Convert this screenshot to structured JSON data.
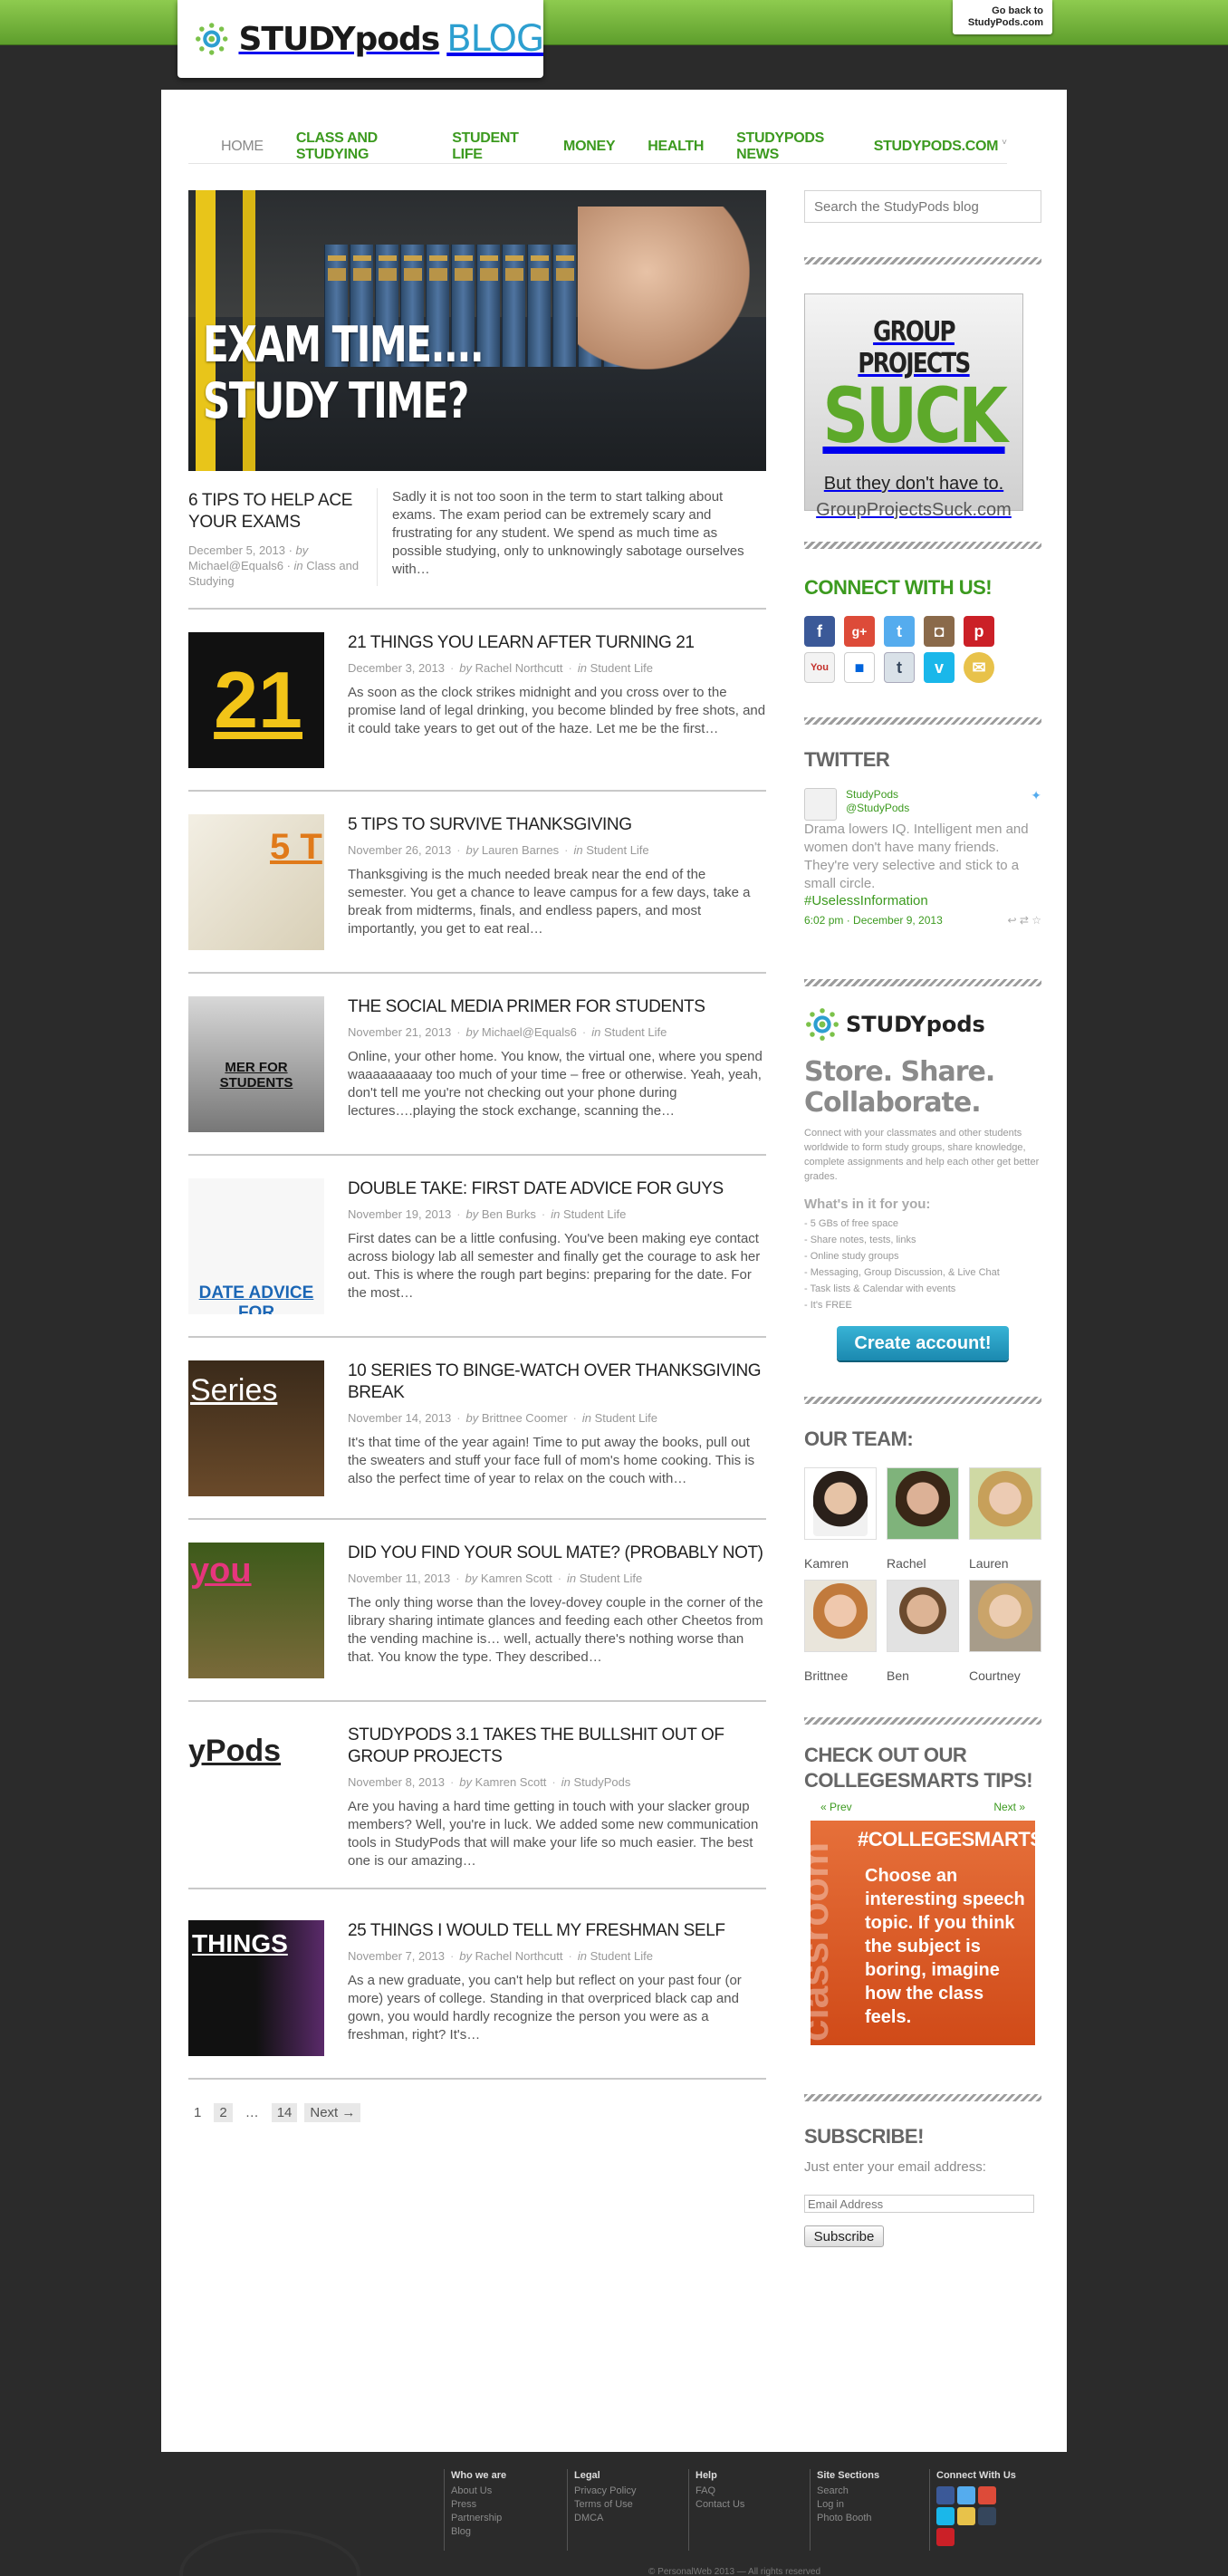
{
  "header": {
    "logo_text": "STUDYpods",
    "logo_blog": "BLOG",
    "back_link": "Go back to StudyPods.com"
  },
  "nav": {
    "items": [
      "HOME",
      "CLASS AND STUDYING",
      "STUDENT LIFE",
      "MONEY",
      "HEALTH",
      "STUDYPODS NEWS",
      "STUDYPODS.COM"
    ]
  },
  "featured": {
    "image_text_line1": "EXAM TIME....",
    "image_text_line2": "STUDY TIME?",
    "title": "6 TIPS TO HELP ACE YOUR EXAMS",
    "date": "December 5, 2013",
    "by": "by",
    "author": "Michael@Equals6",
    "in": "in",
    "category": "Class and Studying",
    "excerpt": "Sadly it is not too soon in the term to start talking about exams.  The exam period can be extremely scary and frustrating for any student. We spend as much time as possible studying, only to unknowingly sabotage ourselves with…"
  },
  "posts": [
    {
      "title": "21 THINGS YOU LEARN AFTER TURNING 21",
      "date": "December 3, 2013",
      "author": "Rachel Northcutt",
      "category": "Student Life",
      "excerpt": "As soon as the clock strikes midnight and you cross over to the promise land of legal drinking, you become blinded by free shots, and it could take years to get out of the haze. Let me be the first…",
      "thumb_text": "21"
    },
    {
      "title": "5 TIPS TO SURVIVE THANKSGIVING",
      "date": "November 26, 2013",
      "author": "Lauren Barnes",
      "category": "Student Life",
      "excerpt": "Thanksgiving is the much needed break near the end of the semester. You get a chance to leave campus for a few days, take a break from midterms, finals, and endless papers, and most importantly, you get to eat real…",
      "thumb_text": "5 T"
    },
    {
      "title": "THE SOCIAL MEDIA PRIMER FOR STUDENTS",
      "date": "November 21, 2013",
      "author": "Michael@Equals6",
      "category": "Student Life",
      "excerpt": "Online, your other home.  You know, the virtual one, where you spend waaaaaaaaay too much of your time – free or otherwise.  Yeah, yeah, don't tell me you're not checking out your phone during lectures….playing the stock exchange, scanning the…",
      "thumb_text": "MER FOR STUDENTS"
    },
    {
      "title": "DOUBLE TAKE: FIRST DATE ADVICE FOR GUYS",
      "date": "November 19, 2013",
      "author": "Ben Burks",
      "category": "Student Life",
      "excerpt": "First dates can be a little confusing. You've been making eye contact across biology lab all semester and finally get the courage to ask her out. This is where the rough part begins: preparing for the date. For the most…",
      "thumb_text": "DATE ADVICE FOR"
    },
    {
      "title": "10 SERIES TO BINGE-WATCH OVER THANKSGIVING BREAK",
      "date": "November 14, 2013",
      "author": "Brittnee Coomer",
      "category": "Student Life",
      "excerpt": "It's that time of the year again! Time to put away the books, pull out the sweaters and stuff your face full of mom's home cooking. This is also the perfect time of year to relax on the couch with…",
      "thumb_text": "Series"
    },
    {
      "title": "DID YOU FIND YOUR SOUL MATE? (PROBABLY NOT)",
      "date": "November 11, 2013",
      "author": "Kamren Scott",
      "category": "Student Life",
      "excerpt": "The only thing worse than the lovey-dovey couple in the corner of the library sharing intimate glances and feeding each other Cheetos from the vending machine is… well, actually there's nothing worse than that. You know the type. They described…",
      "thumb_text": "you"
    },
    {
      "title": "STUDYPODS 3.1 TAKES THE BULLSHIT OUT OF GROUP PROJECTS",
      "date": "November 8, 2013",
      "author": "Kamren Scott",
      "category": "StudyPods",
      "excerpt": "Are you having a hard time getting in touch with your slacker group members? Well, you're in luck. We added some new communication tools in StudyPods that will make your life so much easier. The best one is our amazing…",
      "thumb_text": "yPods"
    },
    {
      "title": "25 THINGS I WOULD TELL MY FRESHMAN SELF",
      "date": "November 7, 2013",
      "author": "Rachel Northcutt",
      "category": "Student Life",
      "excerpt": "As a new graduate, you can't help but reflect on your past four (or more) years of college.  Standing in that overpriced black cap and gown, you would hardly recognize the person you were as a freshman, right?   It's…",
      "thumb_text": "THINGS"
    }
  ],
  "meta_words": {
    "by": "by",
    "in": "in"
  },
  "pagination": {
    "p1": "1",
    "p2": "2",
    "dots": "…",
    "last": "14",
    "next": "Next →"
  },
  "sidebar": {
    "search_placeholder": "Search the StudyPods blog",
    "ad": {
      "l1": "GROUP PROJECTS",
      "l2": "SUCK",
      "l3": "But they don't have to.",
      "l4": "GroupProjectsSuck.com"
    },
    "connect_title": "CONNECT WITH US!",
    "twitter": {
      "title": "TWITTER",
      "name": "StudyPods",
      "handle": "@StudyPods",
      "text": "Drama lowers IQ. Intelligent men and women don't have many friends. They're very selective and stick to a small circle.",
      "tag": "#UselessInformation",
      "time": "6:02 pm · December 9, 2013"
    },
    "studypods": {
      "logo": "STUDYpods",
      "title": "Store. Share. Collaborate.",
      "sub": "Connect with your classmates and other students worldwide to form study groups, share knowledge, complete assignments and help each other get better grades.",
      "h": "What's in it for you:",
      "list": [
        "- 5 GBs of free space",
        "- Share notes, tests, links",
        "- Online study groups",
        "- Messaging, Group Discussion, & Live Chat",
        "- Task lists & Calendar with events",
        "- It's FREE"
      ],
      "button": "Create account!"
    },
    "team_title": "OUR TEAM:",
    "team": [
      "Kamren",
      "Rachel",
      "Lauren",
      "Brittnee",
      "Ben",
      "Courtney"
    ],
    "cs_title": "CHECK OUT OUR COLLEGESMARTS TIPS!",
    "cs_prev": "« Prev",
    "cs_next": "Next »",
    "cs_hash": "#COLLEGESMARTS",
    "cs_vert": "classroom",
    "cs_msg": "Choose an interesting speech topic.  If you think the subject is boring, imagine how the class feels.",
    "subscribe_title": "SUBSCRIBE!",
    "subscribe_label": "Just enter your email address:",
    "email_placeholder": "Email Address",
    "subscribe_button": "Subscribe"
  },
  "footer": {
    "cols": [
      {
        "h": "Who we are",
        "items": [
          "About Us",
          "Press",
          "Partnership",
          "Blog"
        ]
      },
      {
        "h": "Legal",
        "items": [
          "Privacy Policy",
          "Terms of Use",
          "DMCA"
        ]
      },
      {
        "h": "Help",
        "items": [
          "FAQ",
          "Contact Us"
        ]
      },
      {
        "h": "Site Sections",
        "items": [
          "Search",
          "Log in",
          "Photo Booth"
        ]
      },
      {
        "h": "Connect With Us",
        "items": []
      }
    ],
    "copyright": "© PersonalWeb 2013 — All rights reserved"
  },
  "colors": {
    "accent_green": "#3c9a1f",
    "topbar_green": "#8ecb4f",
    "button_blue": "#1b89b0",
    "background": "#2b2b2b"
  }
}
